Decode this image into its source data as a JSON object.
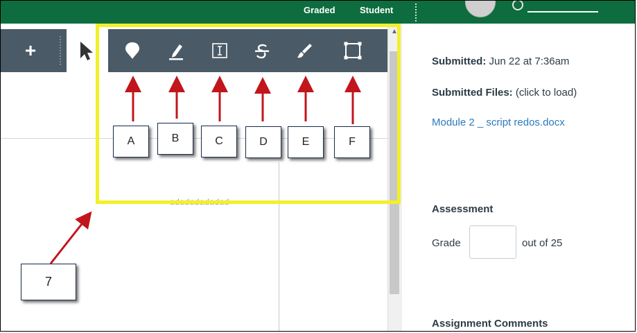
{
  "topbar": {
    "graded_label": "Graded",
    "student_label": "Student"
  },
  "toolbar": {
    "plus_label": "+",
    "tools": [
      {
        "icon": "pin-icon",
        "callout": "A"
      },
      {
        "icon": "highlighter-icon",
        "callout": "B"
      },
      {
        "icon": "text-box-icon",
        "callout": "C"
      },
      {
        "icon": "strikeout-icon",
        "callout": "D"
      },
      {
        "icon": "brush-icon",
        "callout": "E"
      },
      {
        "icon": "area-icon",
        "callout": "F"
      }
    ]
  },
  "document": {
    "ghost_text": "adadadadadad"
  },
  "annotation": {
    "step_label": "7",
    "highlight_color": "#f2f02a",
    "arrow_color": "#c0161c"
  },
  "submission": {
    "submitted_label": "Submitted:",
    "submitted_value": "Jun 22 at 7:36am",
    "files_label": "Submitted Files:",
    "files_hint": "(click to load)",
    "file_link": "Module 2 _ script redos.docx"
  },
  "assessment": {
    "heading": "Assessment",
    "grade_label": "Grade",
    "grade_value": "",
    "out_of": "out of 25"
  },
  "comments": {
    "heading": "Assignment Comments"
  },
  "colors": {
    "topbar": "#0e6d3f",
    "toolbar": "#4a5a66",
    "link": "#2b7abc"
  }
}
